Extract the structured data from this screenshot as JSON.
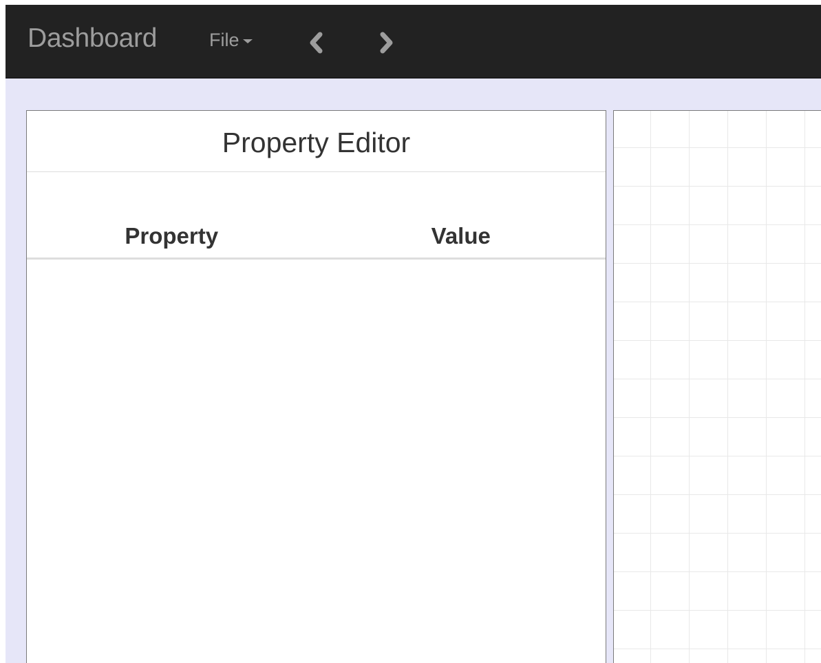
{
  "navbar": {
    "brand": "Dashboard",
    "file_menu": "File",
    "back_icon": "chevron-left-icon",
    "forward_icon": "chevron-right-icon",
    "background": "#222222",
    "text_color": "#9d9d9d"
  },
  "property_editor": {
    "title": "Property Editor",
    "columns": [
      "Property",
      "Value"
    ],
    "rows": []
  },
  "canvas": {
    "grid_color": "#e8e8e8"
  },
  "page": {
    "background": "#e6e6f8"
  }
}
